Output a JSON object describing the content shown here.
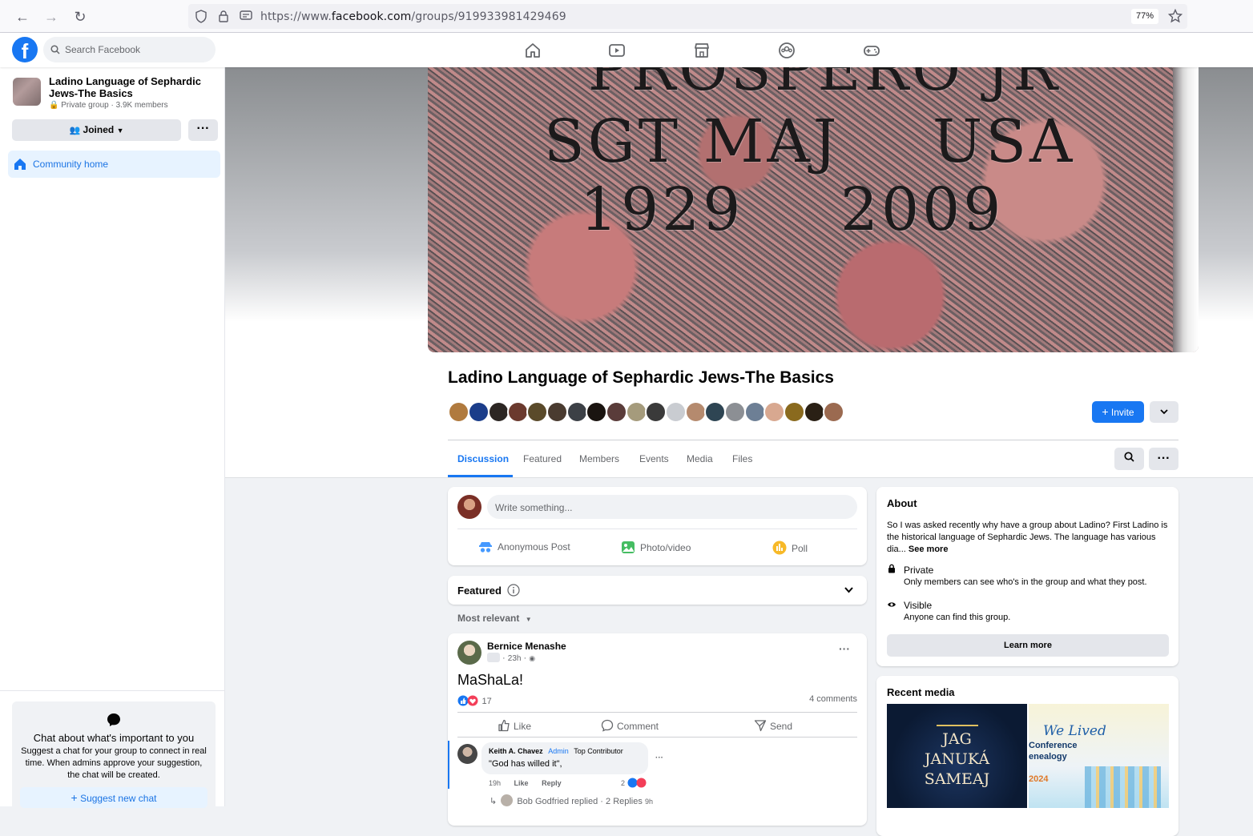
{
  "browser": {
    "url_prefix": "https://www.",
    "url_domain": "facebook.com",
    "url_path": "/groups/919933981429469",
    "zoom": "77%"
  },
  "topbar": {
    "search_placeholder": "Search Facebook",
    "nav_icons": [
      "home-icon",
      "video-icon",
      "marketplace-icon",
      "groups-icon",
      "gaming-icon"
    ]
  },
  "sidebar": {
    "group_name": "Ladino Language of Sephardic Jews-The Basics",
    "group_meta": "Private group · 3.9K members",
    "joined_label": "Joined",
    "more_label": "···",
    "community_home": "Community home",
    "chat_title": "Chat about what's important to you",
    "chat_desc": "Suggest a chat for your group to connect in real time. When admins approve your suggestion, the chat will be created.",
    "suggest_label": "Suggest new chat"
  },
  "cover": {
    "line1": "PROSPERO JR",
    "line2a": "SGT MAJ",
    "line2b": "USA",
    "line3a": "1929",
    "line3b": "2009"
  },
  "header": {
    "title": "Ladino Language of Sephardic Jews-The Basics",
    "invite_label": "Invite",
    "member_avatar_count": 20
  },
  "tabs": [
    {
      "label": "Discussion",
      "active": true
    },
    {
      "label": "Featured"
    },
    {
      "label": "Members"
    },
    {
      "label": "Events"
    },
    {
      "label": "Media"
    },
    {
      "label": "Files"
    }
  ],
  "composer": {
    "placeholder": "Write something...",
    "actions": [
      "Anonymous Post",
      "Photo/video",
      "Poll"
    ]
  },
  "featured": {
    "label": "Featured"
  },
  "sort": {
    "label": "Most relevant"
  },
  "post": {
    "author": "Bernice Menashe",
    "time": "23h",
    "body": "MaShaLa!",
    "reactions_count": "17",
    "comments_count": "4 comments",
    "actions": [
      "Like",
      "Comment",
      "Send"
    ],
    "comment": {
      "author": "Keith A. Chavez",
      "badge_admin": "Admin",
      "badge_contrib": "Top Contributor",
      "text": "\"God has willed it\",",
      "time": "19h",
      "like": "Like",
      "reply": "Reply",
      "reactions": "2",
      "replies_summary": "Bob Godfried replied · 2 Replies",
      "replies_time": "9h"
    }
  },
  "about": {
    "title": "About",
    "text": "So I was asked recently why have a group about Ladino? First Ladino is the historical language of Sephardic Jews. The language has various dia...",
    "see_more": "See more",
    "private_title": "Private",
    "private_desc": "Only members can see who's in the group and what they post.",
    "visible_title": "Visible",
    "visible_desc": "Anyone can find this group.",
    "learn_more": "Learn more"
  },
  "recent_media": {
    "title": "Recent media",
    "item1": {
      "line1": "JAG",
      "line2": "JANUKÁ",
      "line3": "SAMEAJ"
    },
    "item2": {
      "line1": "We Lived",
      "line2": "Conference",
      "line3": "enealogy",
      "line4": "2024"
    }
  },
  "colors": {
    "fb_blue": "#1877f2",
    "bg": "#f0f2f5",
    "muted": "#65676b"
  }
}
